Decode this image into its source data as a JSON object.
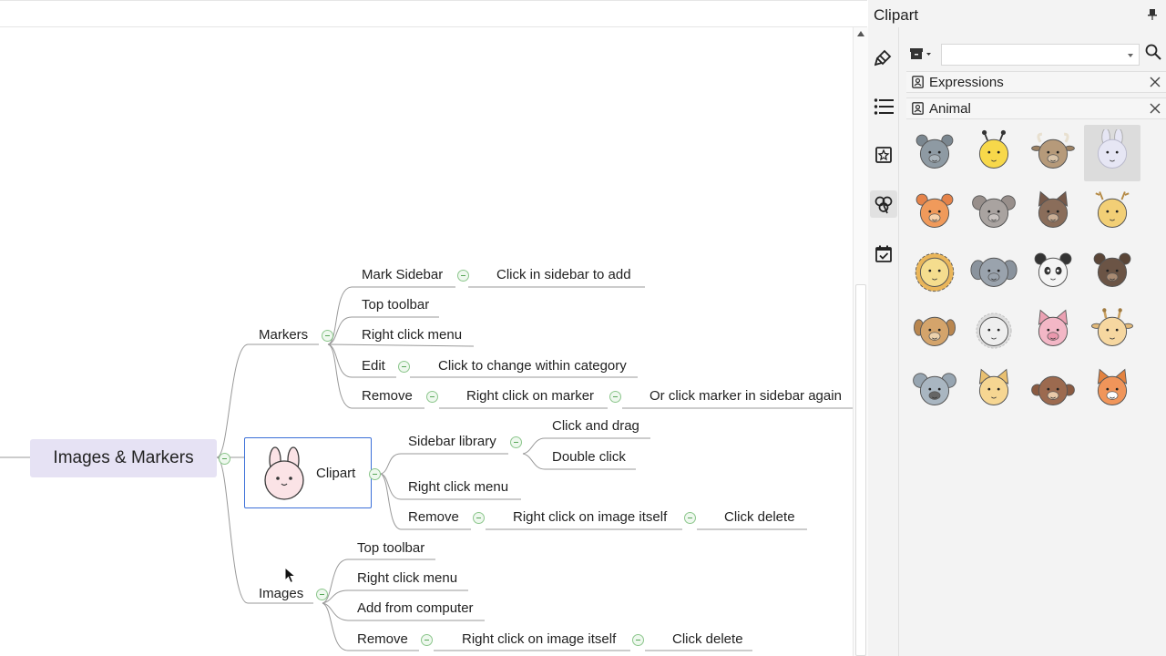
{
  "panel": {
    "title": "Clipart",
    "search": {
      "value": "",
      "placeholder": ""
    },
    "groups": [
      {
        "title": "Expressions"
      },
      {
        "title": "Animal"
      }
    ],
    "animals": [
      {
        "name": "hippo"
      },
      {
        "name": "bee"
      },
      {
        "name": "ox"
      },
      {
        "name": "rabbit",
        "selected": true
      },
      {
        "name": "tiger"
      },
      {
        "name": "mouse"
      },
      {
        "name": "horse"
      },
      {
        "name": "deer"
      },
      {
        "name": "lion"
      },
      {
        "name": "elephant"
      },
      {
        "name": "panda"
      },
      {
        "name": "bear"
      },
      {
        "name": "dog"
      },
      {
        "name": "sheep"
      },
      {
        "name": "pig"
      },
      {
        "name": "giraffe"
      },
      {
        "name": "koala"
      },
      {
        "name": "cat"
      },
      {
        "name": "monkey"
      },
      {
        "name": "fox"
      }
    ],
    "tools": [
      "format-brush-icon",
      "outline-list-icon",
      "marker-icon",
      "clipart-icon",
      "task-icon"
    ]
  },
  "map": {
    "central": "Images & Markers",
    "markers": {
      "label": "Markers",
      "mark_sidebar": "Mark Sidebar",
      "click_in_sidebar": "Click in sidebar to add",
      "top_toolbar": "Top toolbar",
      "right_click_menu": "Right click menu",
      "edit": "Edit",
      "click_change": "Click to change within category",
      "remove": "Remove",
      "right_click_marker": "Right click on marker",
      "or_click_marker": "Or click marker in sidebar again"
    },
    "clipart": {
      "label": "Clipart",
      "sidebar_library": "Sidebar library",
      "click_drag": "Click and drag",
      "double_click": "Double click",
      "right_click_menu": "Right click menu",
      "remove": "Remove",
      "right_click_image": "Right click on image itself",
      "click_delete": "Click delete"
    },
    "images": {
      "label": "Images",
      "top_toolbar": "Top toolbar",
      "right_click_menu": "Right click menu",
      "add_from_computer": "Add from computer",
      "remove": "Remove",
      "right_click_image": "Right click on image itself",
      "click_delete": "Click delete"
    }
  },
  "colors": {
    "selection": "#3b6fd8",
    "central_fill": "#e6e2f4",
    "collapse": "#8cc68c"
  }
}
